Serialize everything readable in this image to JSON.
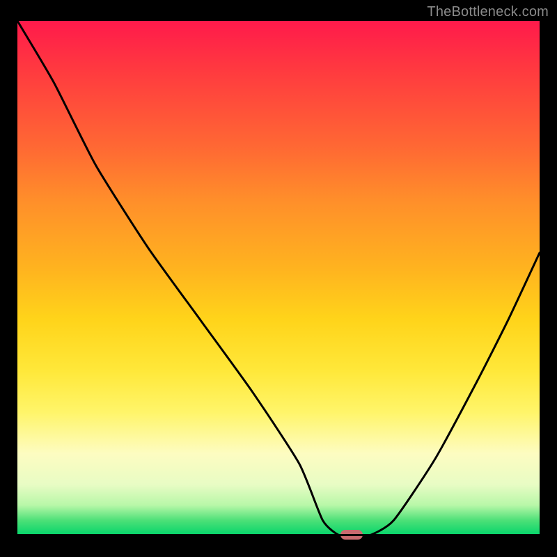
{
  "watermark": "TheBottleneck.com",
  "marker": {
    "x_frac": 0.64,
    "color": "#c96a6f"
  },
  "chart_data": {
    "type": "line",
    "title": "",
    "xlabel": "",
    "ylabel": "",
    "xlim": [
      0,
      1
    ],
    "ylim": [
      0,
      1
    ],
    "series": [
      {
        "name": "bottleneck-curve",
        "x": [
          0.0,
          0.07,
          0.15,
          0.25,
          0.35,
          0.45,
          0.54,
          0.585,
          0.62,
          0.67,
          0.72,
          0.8,
          0.88,
          0.94,
          1.0
        ],
        "y": [
          1.0,
          0.88,
          0.72,
          0.56,
          0.42,
          0.28,
          0.14,
          0.03,
          0.0,
          0.0,
          0.03,
          0.15,
          0.3,
          0.42,
          0.55
        ]
      }
    ],
    "gradient_stops": [
      {
        "pos": 0.0,
        "color": "#ff1a4b"
      },
      {
        "pos": 0.5,
        "color": "#ffd41a"
      },
      {
        "pos": 0.85,
        "color": "#fdfcc1"
      },
      {
        "pos": 1.0,
        "color": "#00d46a"
      }
    ]
  }
}
